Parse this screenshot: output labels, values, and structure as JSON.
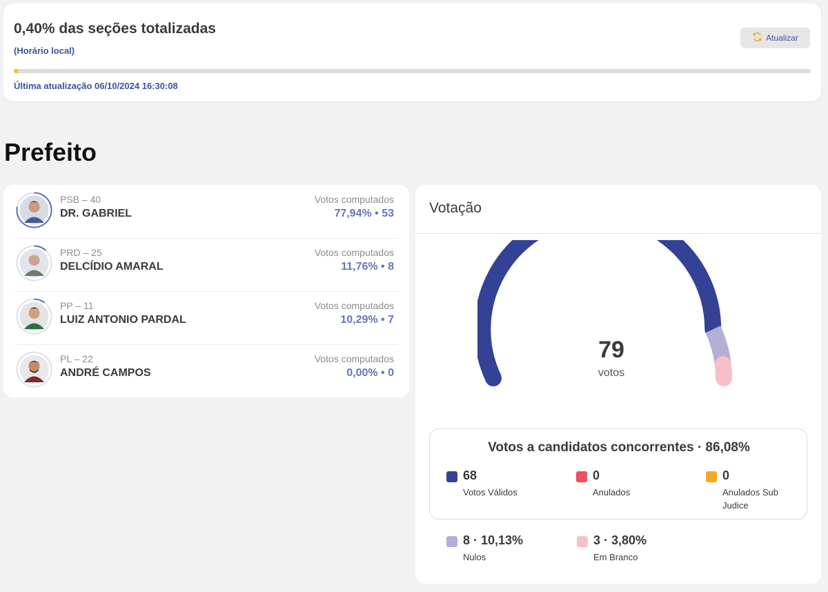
{
  "status": {
    "title": "0,40% das seções totalizadas",
    "subtitle": "(Horário local)",
    "refresh_label": "Atualizar",
    "progress_fraction": 0.004,
    "last_update": "Última atualização 06/10/2024 16:30:08",
    "progress_color": "#f2c418"
  },
  "section_title": "Prefeito",
  "candidates": [
    {
      "party": "PSB – 40",
      "name": "DR. GABRIEL",
      "votes_label": "Votos computados",
      "votes": "77,94%  •  53",
      "share": 0.7794
    },
    {
      "party": "PRD – 25",
      "name": "DELCÍDIO AMARAL",
      "votes_label": "Votos computados",
      "votes": "11,76%  •  8",
      "share": 0.1176
    },
    {
      "party": "PP – 11",
      "name": "LUIZ ANTONIO PARDAL",
      "votes_label": "Votos computados",
      "votes": "10,29%  •  7",
      "share": 0.1029
    },
    {
      "party": "PL – 22",
      "name": "ANDRÉ CAMPOS",
      "votes_label": "Votos computados",
      "votes": "0,00%  •  0",
      "share": 0
    }
  ],
  "voting": {
    "header": "Votação",
    "total": "79",
    "total_unit": "votos",
    "gauge_shares": {
      "valid": 68,
      "null": 8,
      "blank": 3
    },
    "colors": {
      "valid": "#334295",
      "annulled": "#f04e5e",
      "sub_judice": "#f5a623",
      "null": "#b3b0d6",
      "blank": "#f7c0c8"
    },
    "concurrent_title": "Votos a candidatos concorrentes · 86,08%",
    "legend": {
      "valid": {
        "value": "68",
        "label": "Votos Válidos"
      },
      "annulled": {
        "value": "0",
        "label": "Anulados"
      },
      "sub_judice": {
        "value": "0",
        "label": "Anulados Sub Judice"
      },
      "null": {
        "value": "8 · 10,13%",
        "label": "Nulos"
      },
      "blank": {
        "value": "3 · 3,80%",
        "label": "Em Branco"
      }
    }
  }
}
